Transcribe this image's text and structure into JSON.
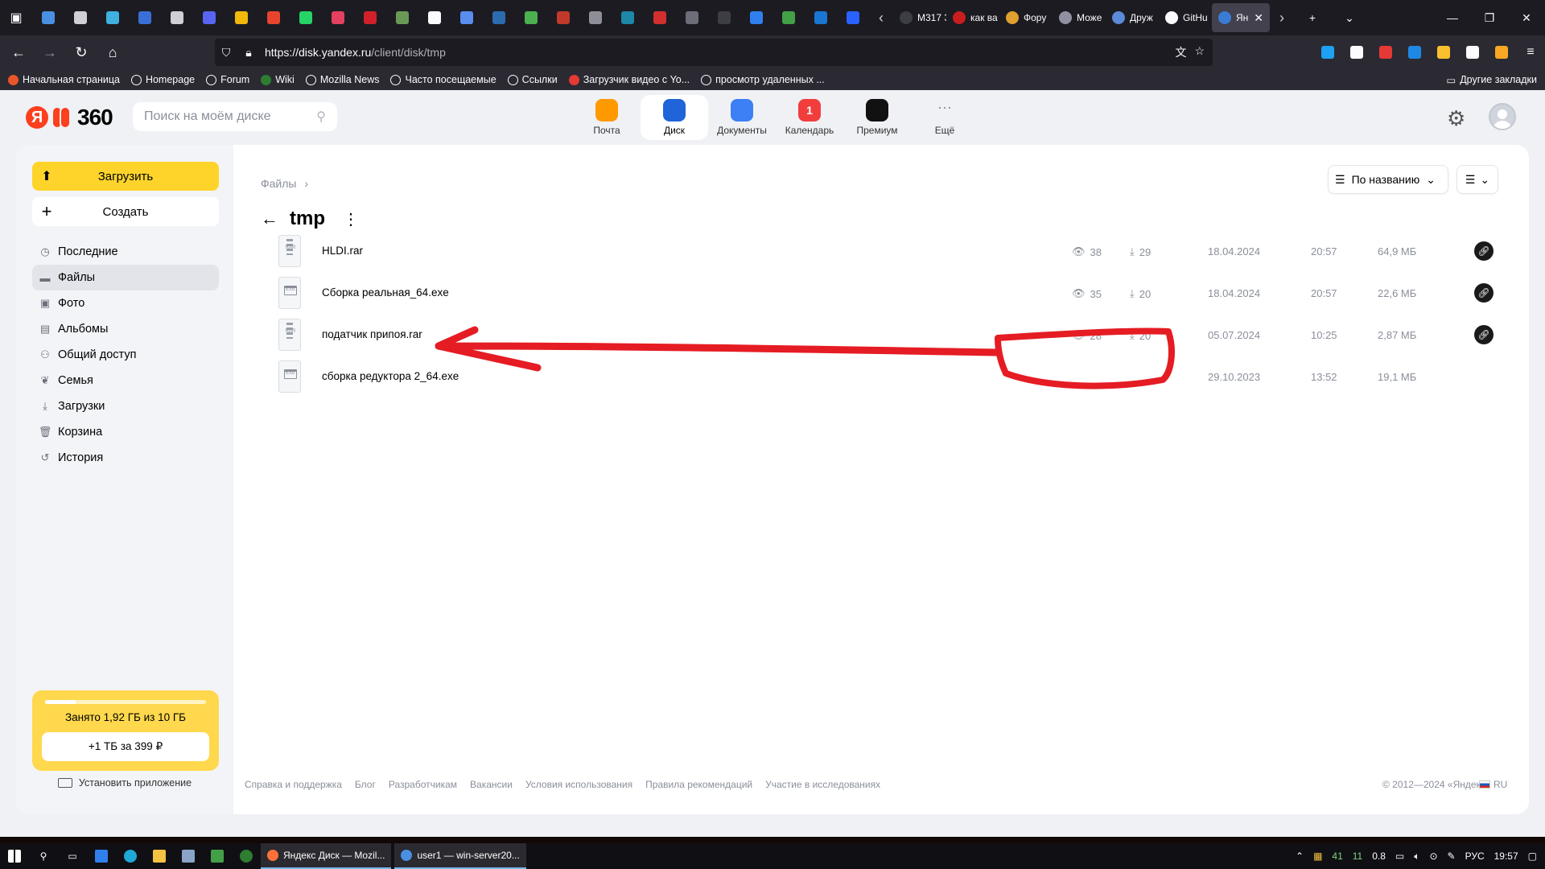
{
  "browser": {
    "tabs": [
      {
        "label": "M317 3-1",
        "color": "#3d3d46"
      },
      {
        "label": "как ва",
        "color": "#c81e1e"
      },
      {
        "label": "Фору",
        "color": "#e0a030"
      },
      {
        "label": "Може",
        "color": "#9090a0"
      },
      {
        "label": "Друж",
        "color": "#5a8ad8"
      },
      {
        "label": "GitHu",
        "color": "#fbfbfe"
      },
      {
        "label": "Ян",
        "color": "#3a7bd5"
      }
    ],
    "pinned_colors": [
      "#4a90e2",
      "#cfcfd8",
      "#3fb0e0",
      "#3a6fd8",
      "#cfcfd8",
      "#5865f2",
      "#f0b90b",
      "#e8442e",
      "#25d366",
      "#e4405f",
      "#d0202a",
      "#6a9955",
      "#fbfbfe",
      "#5b8def",
      "#2b6cb0",
      "#4caf50",
      "#c0392b",
      "#8e8e98",
      "#1e88a8",
      "#d32f2f",
      "#6d6d7a",
      "#3d3d46",
      "#2f80ed",
      "#43a047",
      "#1976d2",
      "#2962ff"
    ],
    "url": {
      "host": "https://disk.yandex.ru",
      "path": "/client/disk/tmp"
    },
    "extension_colors": [
      "#1da1f2",
      "#fbfbfe",
      "#e53935",
      "#1e88e5",
      "#fbc02d",
      "#fbfbfe",
      "#f9a825"
    ],
    "bookmarks": [
      {
        "label": "Начальная страница",
        "color": "#e8562a"
      },
      {
        "label": "Homepage",
        "color": ""
      },
      {
        "label": "Forum",
        "color": ""
      },
      {
        "label": "Wiki",
        "color": "#2e7d32"
      },
      {
        "label": "Mozilla News",
        "color": ""
      },
      {
        "label": "Часто посещаемые",
        "color": ""
      },
      {
        "label": "Ссылки",
        "color": ""
      },
      {
        "label": "Загрузчик видео с Yo...",
        "color": "#e53935"
      },
      {
        "label": "просмотр удаленных ...",
        "color": ""
      }
    ],
    "other_bookmarks": "Другие закладки"
  },
  "header": {
    "logo_ya": "Я",
    "logo_num": "360",
    "search_placeholder": "Поиск на моём диске",
    "services": [
      {
        "label": "Почта",
        "color": "#ff9900",
        "badge": "",
        "active": false
      },
      {
        "label": "Диск",
        "color": "#1f64d8",
        "badge": "",
        "active": true
      },
      {
        "label": "Документы",
        "color": "#3d7ff5",
        "badge": "",
        "active": false
      },
      {
        "label": "Календарь",
        "color": "#f23d3d",
        "badge": "1",
        "active": false
      },
      {
        "label": "Премиум",
        "color": "#111111",
        "badge": "",
        "active": false
      },
      {
        "label": "Ещё",
        "color": "",
        "badge": "···",
        "active": false
      }
    ]
  },
  "sidebar": {
    "upload": "Загрузить",
    "create": "Создать",
    "items": [
      {
        "label": "Последние",
        "icon": "clock-icon",
        "glyph": "◷",
        "active": false
      },
      {
        "label": "Файлы",
        "icon": "folder-icon",
        "glyph": "▬",
        "active": true
      },
      {
        "label": "Фото",
        "icon": "photo-icon",
        "glyph": "▣",
        "active": false
      },
      {
        "label": "Альбомы",
        "icon": "albums-icon",
        "glyph": "▤",
        "active": false
      },
      {
        "label": "Общий доступ",
        "icon": "people-icon",
        "glyph": "⚇",
        "active": false
      },
      {
        "label": "Семья",
        "icon": "family-icon",
        "glyph": "❦",
        "active": false
      },
      {
        "label": "Загрузки",
        "icon": "download-icon",
        "glyph": "⤓",
        "active": false
      },
      {
        "label": "Корзина",
        "icon": "trash-icon",
        "glyph": "🗑",
        "active": false
      },
      {
        "label": "История",
        "icon": "history-icon",
        "glyph": "↺",
        "active": false
      }
    ],
    "storage": {
      "used_text": "Занято 1,92 ГБ из 10 ГБ",
      "fraction": 0.192,
      "buy": "+1 ТБ за 399 ₽"
    },
    "install": "Установить приложение"
  },
  "main": {
    "breadcrumb": "Файлы",
    "breadcrumb_sep": "›",
    "title": "tmp",
    "sort": "По названию",
    "files": [
      {
        "name": "HLDI.rar",
        "type": "rar",
        "ext": "RAR",
        "views": "38",
        "downloads": "29",
        "date": "18.04.2024",
        "time": "20:57",
        "size": "64,9 МБ",
        "shared": true
      },
      {
        "name": "Сборка реальная_64.exe",
        "type": "exe",
        "ext": "EXE",
        "views": "35",
        "downloads": "20",
        "date": "18.04.2024",
        "time": "20:57",
        "size": "22,6 МБ",
        "shared": true
      },
      {
        "name": "податчик припоя.rar",
        "type": "rar",
        "ext": "RAR",
        "views": "28",
        "downloads": "20",
        "date": "05.07.2024",
        "time": "10:25",
        "size": "2,87 МБ",
        "shared": true
      },
      {
        "name": "сборка редуктора 2_64.exe",
        "type": "exe",
        "ext": "EXE",
        "views": "",
        "downloads": "",
        "date": "29.10.2023",
        "time": "13:52",
        "size": "19,1 МБ",
        "shared": false
      }
    ]
  },
  "footer": {
    "links": [
      "Справка и поддержка",
      "Блог",
      "Разработчикам",
      "Вакансии",
      "Условия использования",
      "Правила рекомендаций",
      "Участие в исследованиях"
    ],
    "copyright": "© 2012—2024 «Яндекс»",
    "lang": "RU"
  },
  "annotation": {
    "color": "#e51c23"
  },
  "taskbar": {
    "apps": [
      {
        "label": "Яндекс Диск — Mozil...",
        "color": "#ff7139"
      },
      {
        "label": "user1 — win-server20...",
        "color": "#4a90e2"
      }
    ],
    "tray": {
      "n1": "41",
      "n2": "11",
      "n3": "0.8",
      "lang": "РУС",
      "time": "19:57"
    }
  }
}
